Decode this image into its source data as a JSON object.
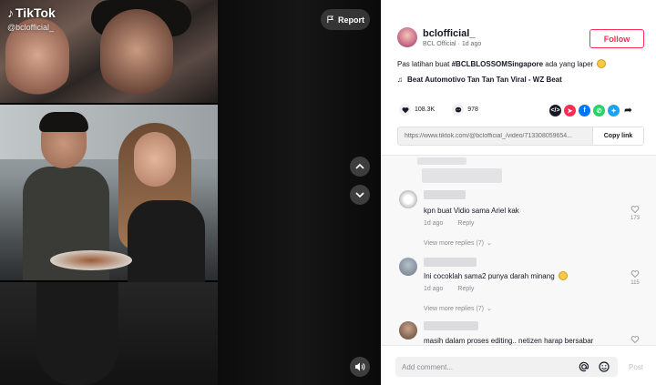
{
  "video": {
    "brand": "TikTok",
    "handle": "@bclofficial_",
    "report_label": "Report"
  },
  "author": {
    "username": "bclofficial_",
    "display_name": "BCL Official",
    "separator": "·",
    "posted": "1d ago",
    "follow_label": "Follow"
  },
  "caption": {
    "text": "Pas latihan buat ",
    "hashtag": "#BCLBLOSSOMSingapore",
    "text_after": " ada yang laper"
  },
  "music": "Beat Automotivo Tan Tan Tan Viral - WZ Beat",
  "stats": {
    "likes": "108.3K",
    "comments": "978"
  },
  "share": {
    "colors": {
      "embed": "#161823",
      "tiktok": "#fe2c55",
      "facebook": "#0075fa",
      "whatsapp": "#25d366",
      "twitter": "#1da1f2"
    }
  },
  "link": {
    "url": "https://www.tiktok.com/@bclofficial_/video/713308059654...",
    "copy_label": "Copy link"
  },
  "comments": [
    {
      "text": "kpn buat Vidio sama Ariel kak",
      "time": "1d ago",
      "reply": "Reply",
      "likes": "173",
      "more": "View more replies (7)"
    },
    {
      "text": "Ini cocoklah sama2 punya darah minang",
      "time": "1d ago",
      "reply": "Reply",
      "likes": "115",
      "more": "View more replies (7)"
    },
    {
      "text": "masih dalam proses editing.. netizen harap bersabar"
    }
  ],
  "input": {
    "placeholder": "Add comment...",
    "post_label": "Post"
  }
}
